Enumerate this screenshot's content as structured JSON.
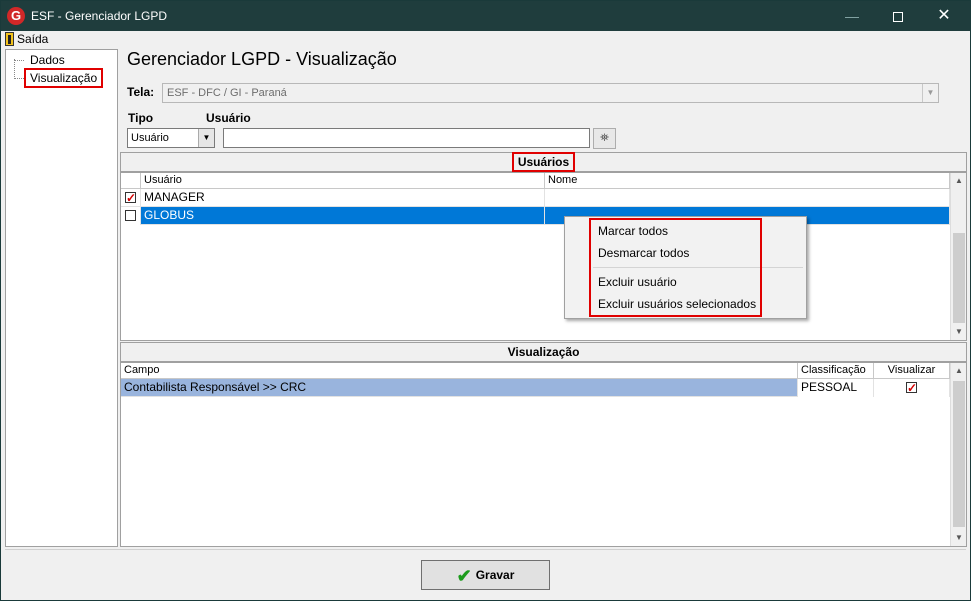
{
  "window": {
    "logo": "G",
    "title": "ESF - Gerenciador LGPD",
    "minimize_glyph": "—",
    "close_glyph": "✕"
  },
  "menubar": {
    "exit_label": "Saída",
    "exit_icon": "door-exit-icon"
  },
  "tree": {
    "items": [
      {
        "label": "Dados"
      },
      {
        "label": "Visualização",
        "selected": true
      }
    ]
  },
  "page": {
    "title": "Gerenciador LGPD - Visualização"
  },
  "tela": {
    "label": "Tela:",
    "value": "ESF - DFC / GI - Paraná",
    "arrow": "▼"
  },
  "filter": {
    "tipo_label": "Tipo",
    "usuario_label": "Usuário",
    "tipo_value": "Usuário",
    "tipo_arrow": "▼",
    "usuario_value": "",
    "search_icon": "binoculars-icon",
    "search_glyph": "⛯"
  },
  "usuarios": {
    "section_title": "Usuários",
    "columns": [
      "Usuário",
      "Nome"
    ],
    "rows": [
      {
        "checked": true,
        "usuario": "MANAGER",
        "nome": ""
      },
      {
        "checked": false,
        "usuario": "GLOBUS",
        "nome": "",
        "selected": true
      }
    ]
  },
  "context_menu": {
    "items": [
      "Marcar todos",
      "Desmarcar todos",
      "Excluir usuário",
      "Excluir usuários selecionados"
    ]
  },
  "visualizacao": {
    "section_title": "Visualização",
    "columns": [
      "Campo",
      "Classificação",
      "Visualizar"
    ],
    "rows": [
      {
        "campo": "Contabilista Responsável >> CRC",
        "classificacao": "PESSOAL",
        "visualizar": true
      }
    ]
  },
  "scroll": {
    "up": "▲",
    "down": "▼"
  },
  "footer": {
    "save_label": "Gravar",
    "save_icon": "checkmark-icon",
    "save_glyph": "✔"
  },
  "colors": {
    "titlebar": "#1f3d3d",
    "selection": "#0078d7",
    "highlight_row": "#99b4dd",
    "annotation": "#e00000",
    "check_red": "#d40000",
    "save_check": "#1c9b1c"
  }
}
